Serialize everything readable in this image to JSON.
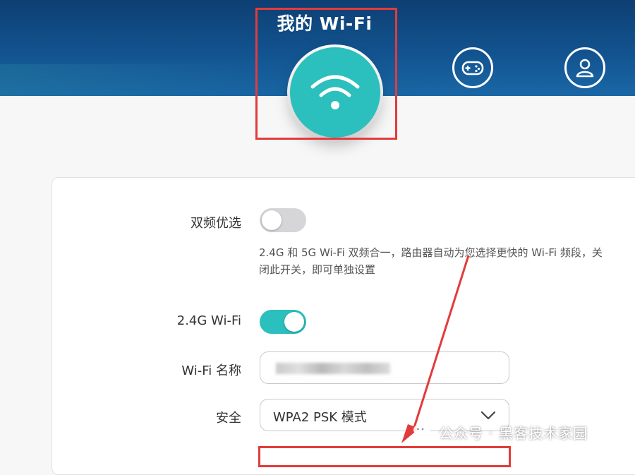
{
  "header": {
    "title": "我的 Wi-Fi",
    "icons": [
      "wifi-icon",
      "gamepad-icon",
      "user-icon"
    ],
    "accent": "#2bbfbd"
  },
  "settings": {
    "dual_band": {
      "label": "双频优选",
      "enabled": false,
      "description": "2.4G 和 5G Wi-Fi 双频合一，路由器自动为您选择更快的 Wi-Fi 频段，关闭此开关，即可单独设置"
    },
    "band_24g": {
      "label": "2.4G Wi-Fi",
      "enabled": true
    },
    "wifi_name": {
      "label": "Wi-Fi 名称",
      "value": ""
    },
    "security": {
      "label": "安全",
      "selected": "WPA2 PSK 模式"
    }
  },
  "watermark": {
    "text": "公众号 · 黑客技术家园"
  },
  "colors": {
    "header_bg": "#12538f",
    "highlight": "#e23b3b",
    "toggle_on": "#2bbfbd",
    "toggle_off": "#d6d6d9"
  }
}
